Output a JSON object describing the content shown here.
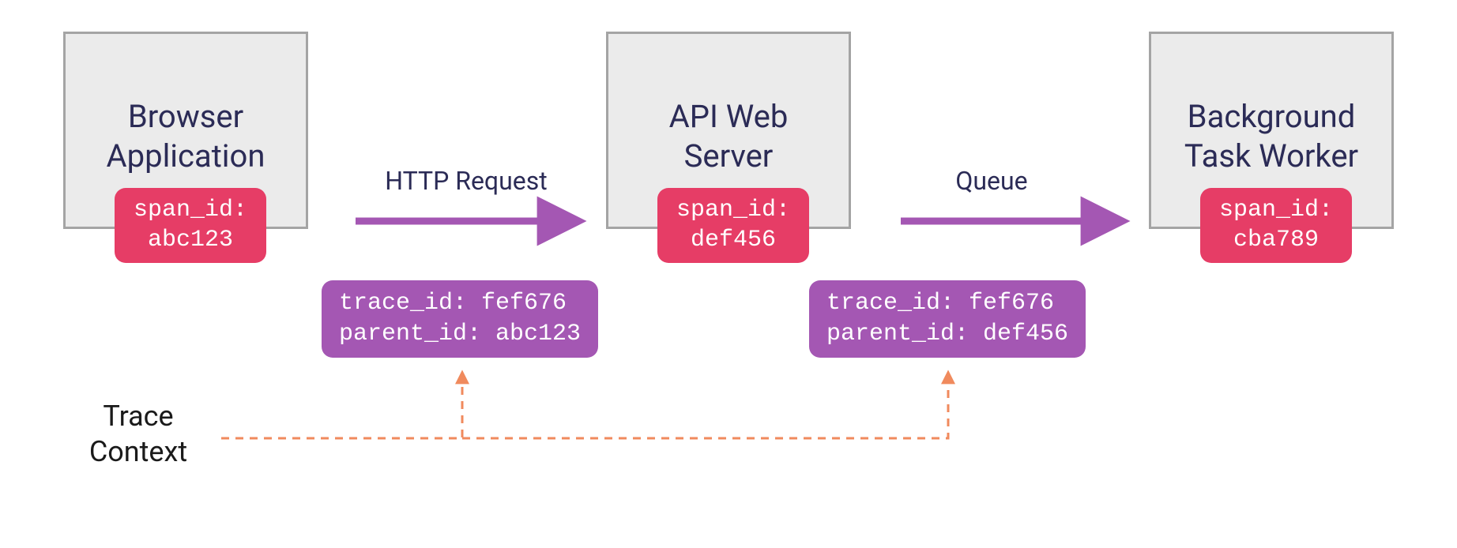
{
  "nodes": {
    "browser": {
      "title": "Browser\nApplication",
      "span_id": "span_id:\nabc123"
    },
    "api": {
      "title": "API Web\nServer",
      "span_id": "span_id:\ndef456"
    },
    "worker": {
      "title": "Background\nTask Worker",
      "span_id": "span_id:\ncba789"
    }
  },
  "arrows": {
    "http": "HTTP Request",
    "queue": "Queue"
  },
  "contexts": {
    "ctx1": "trace_id: fef676\nparent_id: abc123",
    "ctx2": "trace_id: fef676\nparent_id: def456"
  },
  "trace_context_label": "Trace\nContext"
}
